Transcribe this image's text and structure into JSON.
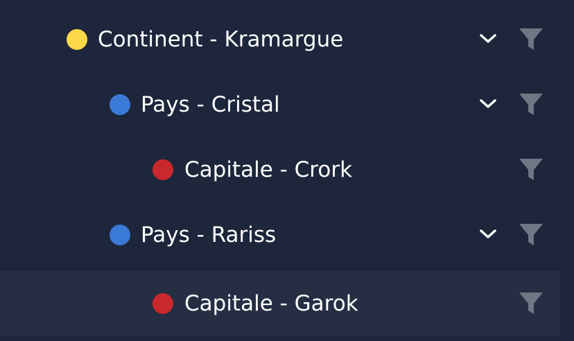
{
  "colors": {
    "background": "#1d263b",
    "selected_row": "#252e43",
    "text": "#ffffff",
    "icon": "#6f7785",
    "level_continent": "#fdd74a",
    "level_pays": "#3a79d6",
    "level_capitale": "#c9282c"
  },
  "tree": {
    "rows": [
      {
        "label": "Continent - Kramargue",
        "level": "continent",
        "dot_color": "#fdd74a",
        "expandable": true,
        "expanded": true,
        "selected": false,
        "chevron_icon": "chevron-down-icon",
        "filter_icon": "filter-icon"
      },
      {
        "label": "Pays - Cristal",
        "level": "pays",
        "dot_color": "#3a79d6",
        "expandable": true,
        "expanded": true,
        "selected": false,
        "chevron_icon": "chevron-down-icon",
        "filter_icon": "filter-icon"
      },
      {
        "label": "Capitale - Crork",
        "level": "capitale",
        "dot_color": "#c9282c",
        "expandable": false,
        "selected": false,
        "filter_icon": "filter-icon"
      },
      {
        "label": "Pays - Rariss",
        "level": "pays",
        "dot_color": "#3a79d6",
        "expandable": true,
        "expanded": true,
        "selected": false,
        "chevron_icon": "chevron-down-icon",
        "filter_icon": "filter-icon"
      },
      {
        "label": "Capitale - Garok",
        "level": "capitale",
        "dot_color": "#c9282c",
        "expandable": false,
        "selected": true,
        "filter_icon": "filter-icon"
      }
    ]
  }
}
